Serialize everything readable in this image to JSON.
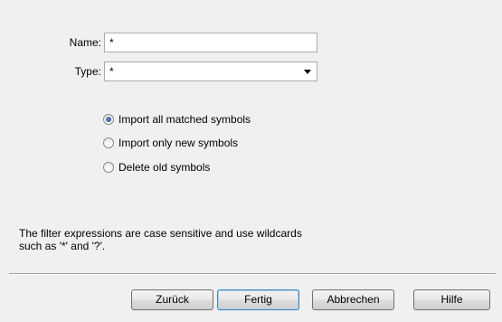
{
  "form": {
    "name_label": "Name:",
    "name_value": "*",
    "type_label": "Type:",
    "type_value": "*"
  },
  "options": {
    "import_all": "Import all matched symbols",
    "import_new": "Import only new symbols",
    "delete_old": "Delete old symbols",
    "selected": "import_all"
  },
  "info": {
    "line1": "The filter expressions are case sensitive and use wildcards",
    "line2": "such as '*' and '?'."
  },
  "buttons": {
    "back": "Zurück",
    "finish": "Fertig",
    "cancel": "Abbrechen",
    "help": "Hilfe"
  }
}
